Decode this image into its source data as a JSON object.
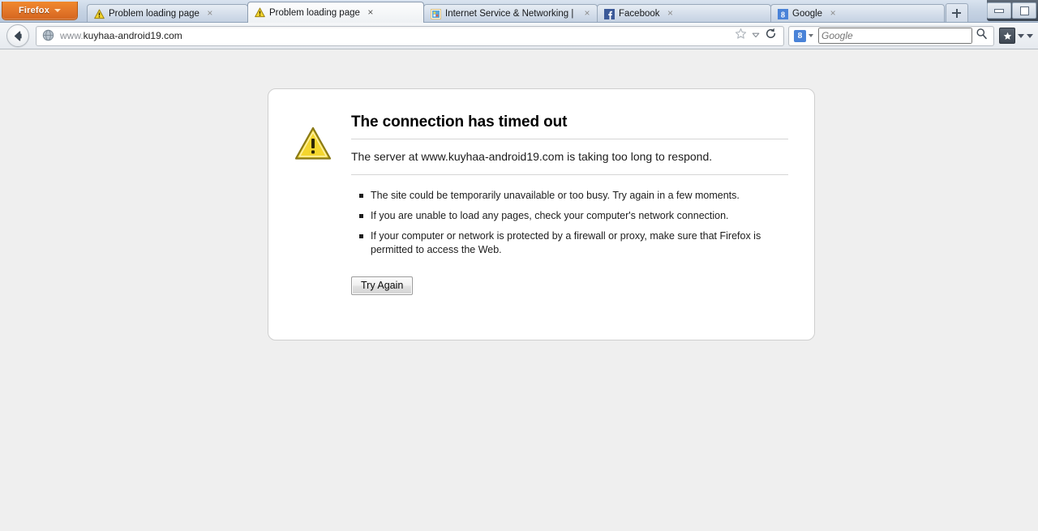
{
  "window": {
    "app_button_label": "Firefox",
    "controls": {
      "minimize": "minimize-icon",
      "restore": "restore-icon"
    }
  },
  "tabs": [
    {
      "title": "Problem loading page",
      "favicon": "warning-triangle-icon",
      "selected": false,
      "close_label": "×"
    },
    {
      "title": "Problem loading page",
      "favicon": "warning-triangle-icon",
      "selected": true,
      "close_label": "×"
    },
    {
      "title": "Internet Service & Networking | ...",
      "favicon": "site-icon",
      "selected": false,
      "close_label": "×"
    },
    {
      "title": "Facebook",
      "favicon": "facebook-icon",
      "selected": false,
      "close_label": "×"
    },
    {
      "title": "Google",
      "favicon": "google-icon",
      "selected": false,
      "close_label": "×"
    }
  ],
  "newtab": {
    "label": "+"
  },
  "navbar": {
    "back_label": "Back",
    "url_prefix": "www.",
    "url_rest": "kuyhaa-android19.com",
    "url_full": "www.kuyhaa-android19.com",
    "bookmark_icon": "star-icon",
    "dropdown_icon": "chevron-down-icon",
    "reload_icon": "reload-icon"
  },
  "search": {
    "engine_label": "8",
    "engine_name": "google-engine-icon",
    "placeholder": "Google",
    "go_icon": "magnifier-icon"
  },
  "toolbar_right": {
    "bookmarks_icon": "star-icon",
    "overflow_icon": "chevron-down-icon"
  },
  "error_page": {
    "icon": "warning-triangle-icon",
    "title": "The connection has timed out",
    "description": "The server at www.kuyhaa-android19.com is taking too long to respond.",
    "bullets": [
      "The site could be temporarily unavailable or too busy. Try again in a few moments.",
      "If you are unable to load any pages, check your computer's network connection.",
      "If your computer or network is protected by a firewall or proxy, make sure that Firefox is permitted to access the Web."
    ],
    "button_label": "Try Again"
  },
  "colors": {
    "accent_orange": "#e4772a",
    "warning_yellow": "#f2d024",
    "page_background": "#efefef",
    "panel_background": "#ffffff",
    "facebook_blue": "#3b5998",
    "google_blue": "#4a83d8"
  }
}
